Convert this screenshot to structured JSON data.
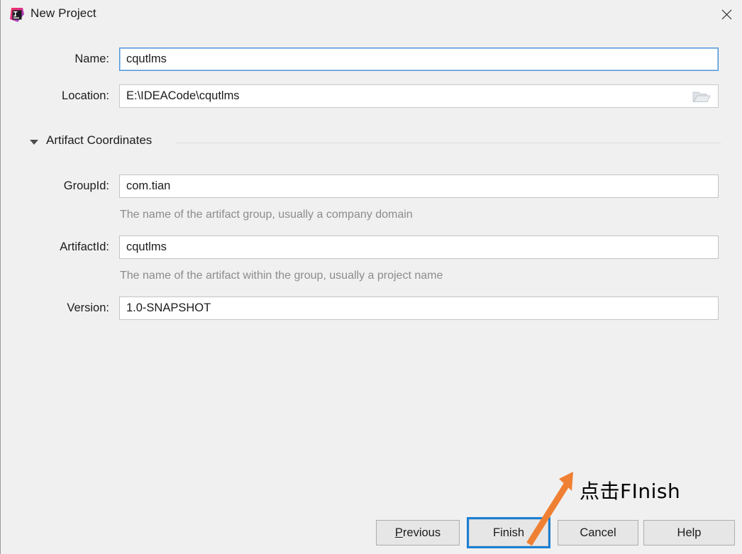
{
  "window": {
    "title": "New Project",
    "app_icon": "intellij-idea-icon",
    "close_icon": "close-icon",
    "background_color": "#f0f0f0"
  },
  "form": {
    "name": {
      "label": "Name:",
      "value": "cqutlms",
      "focused": true
    },
    "location": {
      "label": "Location:",
      "value": "E:\\IDEACode\\cqutlms",
      "browse_icon": "folder-open-icon"
    }
  },
  "artifact_section": {
    "title": "Artifact Coordinates",
    "expanded": true,
    "collapse_icon": "triangle-down-icon",
    "fields": {
      "group_id": {
        "label": "GroupId:",
        "value": "com.tian",
        "hint": "The name of the artifact group, usually a company domain"
      },
      "artifact_id": {
        "label": "ArtifactId:",
        "value": "cqutlms",
        "hint": "The name of the artifact within the group, usually a project name"
      },
      "version": {
        "label": "Version:",
        "value": "1.0-SNAPSHOT"
      }
    }
  },
  "buttons": {
    "previous": {
      "mnemonic": "P",
      "rest": "revious"
    },
    "finish": {
      "before": "",
      "mnemonic": "F",
      "rest": "inish",
      "is_default": true
    },
    "cancel": {
      "label": "Cancel"
    },
    "help": {
      "label": "Help"
    }
  },
  "annotation": {
    "text": "点击FInish",
    "arrow_color": "#ef8033",
    "arrow_icon": "annotation-arrow-icon"
  }
}
